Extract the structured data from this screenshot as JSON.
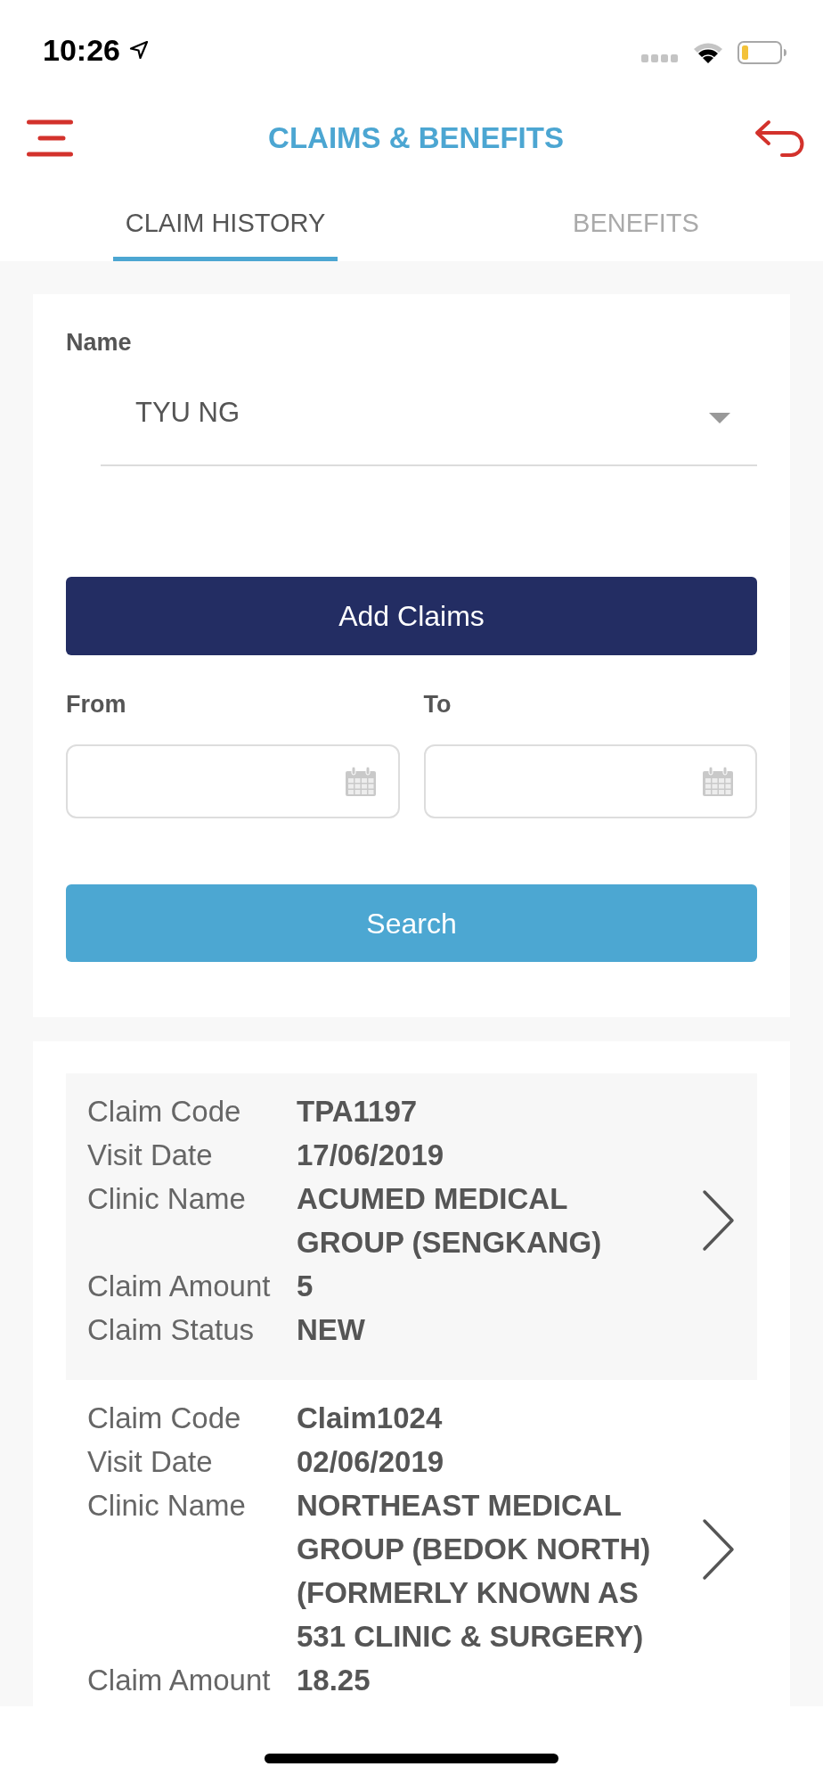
{
  "status_bar": {
    "time": "10:26"
  },
  "header": {
    "title": "CLAIMS & BENEFITS"
  },
  "tabs": [
    {
      "label": "CLAIM HISTORY",
      "selected": true
    },
    {
      "label": "BENEFITS",
      "selected": false
    }
  ],
  "filter": {
    "name_label": "Name",
    "name_value": "TYU NG",
    "add_button": "Add Claims",
    "from_label": "From",
    "to_label": "To",
    "search_button": "Search"
  },
  "claims": [
    {
      "fields": [
        {
          "label": "Claim Code",
          "value": "TPA1197"
        },
        {
          "label": "Visit Date",
          "value": "17/06/2019"
        },
        {
          "label": "Clinic Name",
          "value": "ACUMED MEDICAL GROUP (SENGKANG)"
        },
        {
          "label": "Claim Amount",
          "value": "5"
        },
        {
          "label": "Claim Status",
          "value": "NEW"
        }
      ]
    },
    {
      "fields": [
        {
          "label": "Claim Code",
          "value": "Claim1024"
        },
        {
          "label": "Visit Date",
          "value": "02/06/2019"
        },
        {
          "label": "Clinic Name",
          "value": "NORTHEAST MEDICAL GROUP (BEDOK NORTH) (FORMERLY KNOWN AS 531 CLINIC & SURGERY)"
        },
        {
          "label": "Claim Amount",
          "value": "18.25"
        }
      ]
    }
  ]
}
